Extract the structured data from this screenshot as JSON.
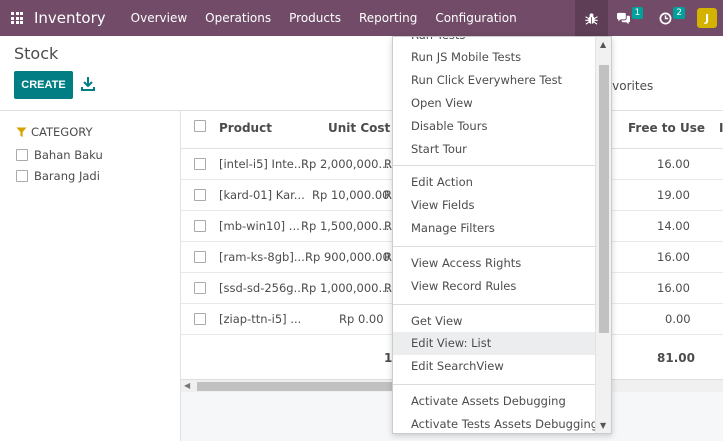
{
  "navbar": {
    "app_name": "Inventory",
    "menu": [
      "Overview",
      "Operations",
      "Products",
      "Reporting",
      "Configuration"
    ],
    "messages_count": "1",
    "activities_count": "2",
    "avatar_initial": "J",
    "colors": {
      "bar": "#714b67",
      "badge": "#00a09d",
      "avatar": "#d4b200"
    }
  },
  "control_panel": {
    "title": "Stock",
    "create_label": "CREATE",
    "favorites_label": "Favorites"
  },
  "sidebar": {
    "header": "CATEGORY",
    "items": [
      "Bahan Baku",
      "Barang Jadi"
    ]
  },
  "table": {
    "columns": {
      "product": "Product",
      "unit_cost": "Unit Cost",
      "free_to_use": "Free to Use"
    },
    "rows": [
      {
        "product": "[intel-i5] Inte...",
        "unit_cost": "Rp 2,000,000...",
        "col3": "R",
        "free_to_use": "16.00"
      },
      {
        "product": "[kard-01] Kar...",
        "unit_cost": "Rp 10,000.00",
        "col3": "R",
        "free_to_use": "19.00"
      },
      {
        "product": "[mb-win10] ...",
        "unit_cost": "Rp 1,500,000...",
        "col3": "R",
        "free_to_use": "14.00"
      },
      {
        "product": "[ram-ks-8gb]...",
        "unit_cost": "Rp 900,000.00",
        "col3": "R",
        "free_to_use": "16.00"
      },
      {
        "product": "[ssd-sd-256g...",
        "unit_cost": "Rp 1,000,000...",
        "col3": "R",
        "free_to_use": "16.00"
      },
      {
        "product": "[ziap-ttn-i5] ...",
        "unit_cost": "Rp 0.00",
        "col3": "",
        "free_to_use": "0.00"
      }
    ],
    "totals": {
      "partial": "1",
      "free_to_use": "81.00"
    }
  },
  "debug_menu": {
    "groups": [
      [
        "Run Tests",
        "Run JS Mobile Tests",
        "Run Click Everywhere Test",
        "Open View",
        "Disable Tours",
        "Start Tour"
      ],
      [
        "Edit Action",
        "View Fields",
        "Manage Filters"
      ],
      [
        "View Access Rights",
        "View Record Rules"
      ],
      [
        "Get View",
        "Edit View: List",
        "Edit SearchView"
      ],
      [
        "Activate Assets Debugging",
        "Activate Tests Assets Debugging"
      ]
    ],
    "active_item": "Edit View: List"
  }
}
